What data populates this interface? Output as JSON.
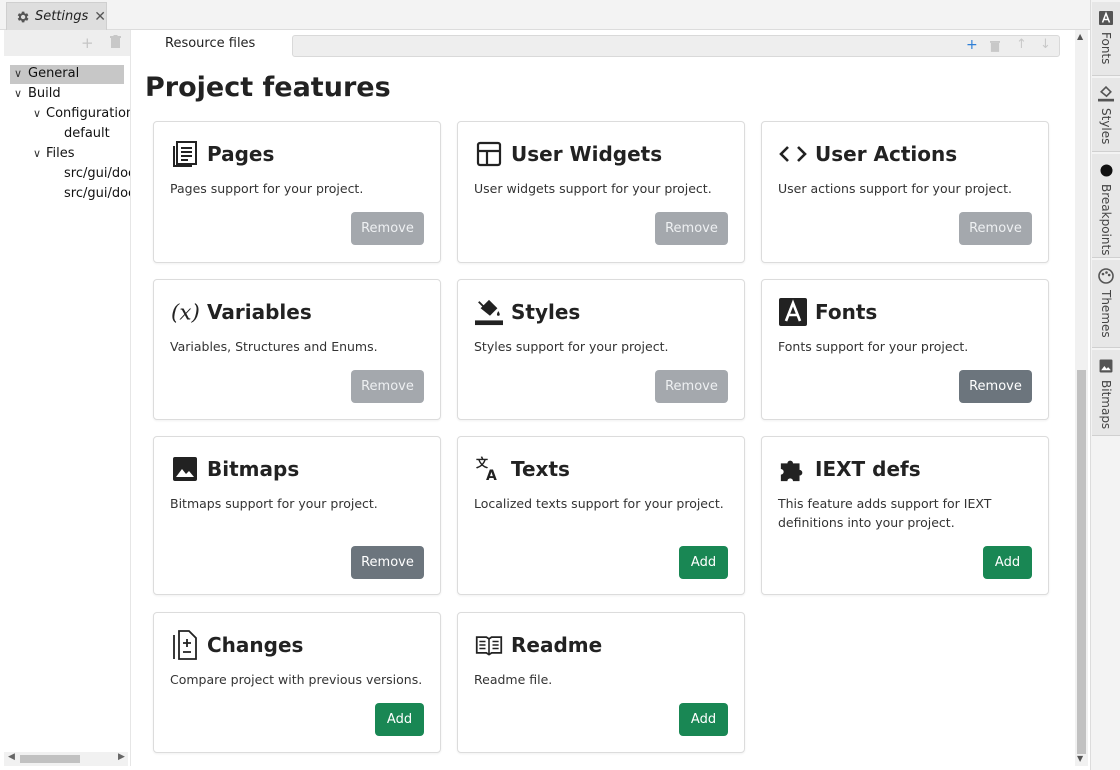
{
  "tab": {
    "title": "Settings",
    "close": "✕"
  },
  "left_toolbar": {
    "add": "+",
    "delete": "🗑"
  },
  "tree": [
    {
      "label": "General",
      "chevron": "∨",
      "selected": true
    },
    {
      "label": "Build",
      "chevron": "∨"
    },
    {
      "label": "Configurations",
      "chevron": "∨"
    },
    {
      "label": "default",
      "chevron": ""
    },
    {
      "label": "Files",
      "chevron": "∨"
    },
    {
      "label": "src/gui/document.xml",
      "chevron": ""
    },
    {
      "label": "src/gui/document.json",
      "chevron": ""
    }
  ],
  "resource": {
    "tab_label": "Resource files",
    "add": "+",
    "delete": "🗑",
    "up": "↑",
    "down": "↓"
  },
  "page_title": "Project features",
  "cards": [
    {
      "title": "Pages",
      "icon": "pages-icon",
      "description": "Pages support for your project.",
      "button": "Remove",
      "action": "remove",
      "faded": true
    },
    {
      "title": "User Widgets",
      "icon": "user-widgets-icon",
      "description": "User widgets support for your project.",
      "button": "Remove",
      "action": "remove",
      "faded": true
    },
    {
      "title": "User Actions",
      "icon": "code-icon",
      "description": "User actions support for your project.",
      "button": "Remove",
      "action": "remove",
      "faded": true
    },
    {
      "title": "Variables",
      "icon": "variables-icon",
      "description": "Variables, Structures and Enums.",
      "button": "Remove",
      "action": "remove",
      "faded": true
    },
    {
      "title": "Styles",
      "icon": "paint-bucket-icon",
      "description": "Styles support for your project.",
      "button": "Remove",
      "action": "remove",
      "faded": true
    },
    {
      "title": "Fonts",
      "icon": "font-icon",
      "description": "Fonts support for your project.",
      "button": "Remove",
      "action": "remove",
      "faded": false
    },
    {
      "title": "Bitmaps",
      "icon": "image-icon",
      "description": "Bitmaps support for your project.",
      "button": "Remove",
      "action": "remove",
      "faded": false
    },
    {
      "title": "Texts",
      "icon": "translate-icon",
      "description": "Localized texts support for your project.",
      "button": "Add",
      "action": "add",
      "faded": false
    },
    {
      "title": "IEXT defs",
      "icon": "puzzle-icon",
      "description": "This feature adds support for IEXT definitions into your project.",
      "button": "Add",
      "action": "add",
      "faded": false
    },
    {
      "title": "Changes",
      "icon": "file-diff-icon",
      "description": "Compare project with previous versions.",
      "button": "Add",
      "action": "add",
      "faded": false
    },
    {
      "title": "Readme",
      "icon": "book-icon",
      "description": "Readme file.",
      "button": "Add",
      "action": "add",
      "faded": false
    }
  ],
  "dock": [
    {
      "label": "Fonts",
      "icon": "font-icon"
    },
    {
      "label": "Styles",
      "icon": "paint-bucket-icon"
    },
    {
      "label": "Breakpoints",
      "icon": "circle-icon"
    },
    {
      "label": "Themes",
      "icon": "palette-icon"
    },
    {
      "label": "Bitmaps",
      "icon": "image-icon"
    }
  ],
  "colors": {
    "add": "#198754",
    "remove": "#6c757d",
    "remove_faded": "#a4a8ad",
    "accent": "#2f7fd6"
  }
}
